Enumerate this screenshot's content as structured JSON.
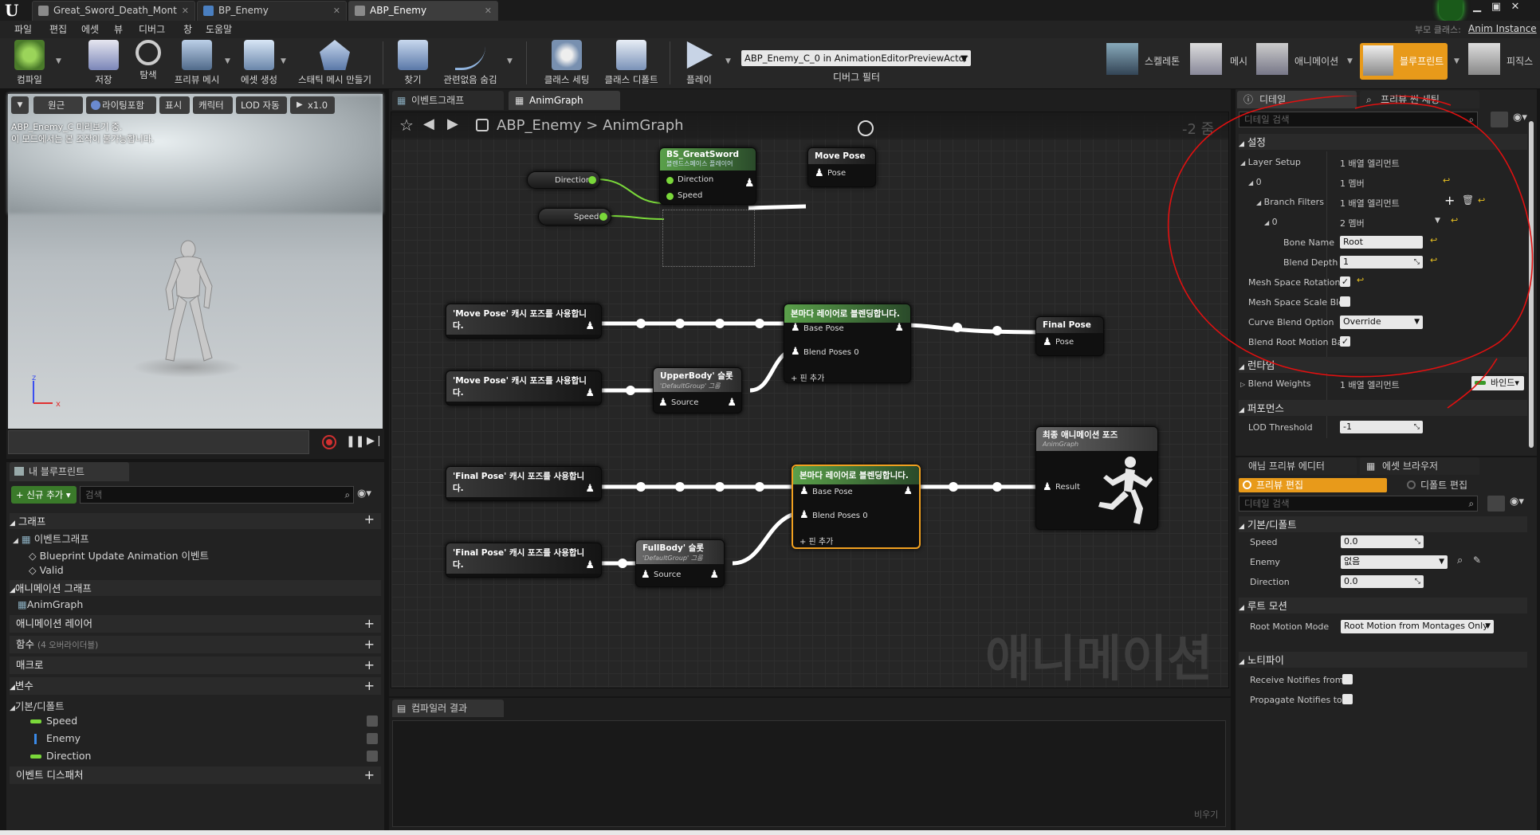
{
  "tabs": [
    {
      "label": "Great_Sword_Death_Mont"
    },
    {
      "label": "BP_Enemy"
    },
    {
      "label": "ABP_Enemy"
    }
  ],
  "parent_class_label": "부모 클래스:",
  "parent_class_value": "Anim Instance",
  "menu": [
    "파일",
    "편집",
    "에셋",
    "뷰",
    "디버그",
    "창",
    "도움말"
  ],
  "toolbar": {
    "compile": "컴파일",
    "save": "저장",
    "browse": "탐색",
    "preview_mesh": "프리뷰 메시",
    "create_asset": "에셋 생성",
    "make_static_mesh": "스태틱 메시 만들기",
    "find": "찾기",
    "hide_unrelated": "관련없음 숨김",
    "class_settings": "클래스 세팅",
    "class_defaults": "클래스 디폴트",
    "play": "플레이",
    "debug_select": "ABP_Enemy_C_0 in AnimationEditorPreviewActor",
    "debug_filter": "디버그 필터"
  },
  "modes": {
    "skeleton": "스켈레톤",
    "mesh": "메시",
    "animation": "애니메이션",
    "blueprint": "블루프린트",
    "physics": "피직스"
  },
  "viewport": {
    "btn_perspective": "원근",
    "btn_lighting": "라이팅포함",
    "btn_show": "표시",
    "btn_character": "캐릭터",
    "btn_lod": "LOD 자동",
    "btn_speed": "x1.0",
    "info1": "ABP_Enemy_C 미리보기 중.",
    "info2": "이 모드에서는 본 조작이 불가능합니다."
  },
  "my_blueprint": {
    "tab": "내 블루프린트",
    "add_new": "+ 신규 추가",
    "search_placeholder": "검색",
    "graphs": "그래프",
    "event_graph": "이벤트그래프",
    "bp_update": "Blueprint Update Animation 이벤트",
    "valid": "Valid",
    "anim_graphs": "애니메이션 그래프",
    "anim_graph": "AnimGraph",
    "anim_layers": "애니메이션 레이어",
    "functions": "함수",
    "functions_count": "(4 오버라이더블)",
    "macros": "매크로",
    "variables": "변수",
    "default_cat": "기본/디폴트",
    "var_speed": "Speed",
    "var_enemy": "Enemy",
    "var_direction": "Direction",
    "dispatchers": "이벤트 디스패처"
  },
  "graph": {
    "tab_event": "이벤트그래프",
    "tab_anim": "AnimGraph",
    "crumb_root": "ABP_Enemy",
    "crumb_sep": ">",
    "crumb_leaf": "AnimGraph",
    "zoom": "-2 줌",
    "watermark": "애니메이션",
    "n_direction": "Direction",
    "n_speed": "Speed",
    "n_bs_title": "BS_GreatSword",
    "n_bs_sub": "블렌드스페이스 플레이어",
    "n_bs_dir": "Direction",
    "n_bs_speed": "Speed",
    "n_movepose": "Move Pose",
    "n_pose": "Pose",
    "n_use_move1": "'Move Pose' 캐시 포즈를 사용합니다.",
    "n_use_move2": "'Move Pose' 캐시 포즈를 사용합니다.",
    "n_layer1": "본마다 레이어로 블렌딩합니다.",
    "n_base": "Base Pose",
    "n_blend0": "Blend Poses 0",
    "n_addpin": "+ 핀 추가",
    "n_upper": "UpperBody' 슬롯",
    "n_upper_sub": "'DefaultGroup' 그룹",
    "n_source": "Source",
    "n_finalpose": "Final Pose",
    "n_use_final1": "'Final Pose' 캐시 포즈를 사용합니다.",
    "n_use_final2": "'Final Pose' 캐시 포즈를 사용합니다.",
    "n_layer2": "본마다 레이어로 블렌딩합니다.",
    "n_full": "FullBody' 슬롯",
    "n_full_sub": "'DefaultGroup' 그룹",
    "n_output": "최종 애니메이션 포즈",
    "n_output_sub": "AnimGraph",
    "n_result": "Result"
  },
  "compiler": {
    "tab": "컴파일러 결과",
    "clear": "비우기"
  },
  "details": {
    "tab": "디테일",
    "tab2": "프리뷰 씬 세팅",
    "search": "디테일 검색",
    "settings": "설정",
    "layer_setup": "Layer Setup",
    "layer_setup_v": "1 배열 엘리먼트",
    "idx0": "0",
    "idx0_v": "1 멤버",
    "branch_filters": "Branch Filters",
    "branch_filters_v": "1 배열 엘리먼트",
    "idx0b": "0",
    "idx0b_v": "2 멤버",
    "bone_name": "Bone Name",
    "bone_name_v": "Root",
    "blend_depth": "Blend Depth",
    "blend_depth_v": "1",
    "mesh_rot": "Mesh Space Rotation",
    "mesh_scale": "Mesh Space Scale Ble",
    "curve_blend": "Curve Blend Option",
    "curve_blend_v": "Override",
    "blend_root": "Blend Root Motion Ba",
    "runtime": "런타임",
    "blend_weights": "Blend Weights",
    "blend_weights_v": "1 배열 엘리먼트",
    "bind": "바인드",
    "perf": "퍼포먼스",
    "lod": "LOD Threshold",
    "lod_v": "-1"
  },
  "preview_editor": {
    "tab": "애님 프리뷰 에디터",
    "tab2": "에셋 브라우저",
    "edit_preview": "프리뷰 편집",
    "edit_defaults": "디폴트 편집",
    "search": "디테일 검색",
    "default_cat": "기본/디폴트",
    "speed": "Speed",
    "speed_v": "0.0",
    "enemy": "Enemy",
    "enemy_v": "없음",
    "direction": "Direction",
    "direction_v": "0.0",
    "root_motion": "루트 모션",
    "root_motion_mode": "Root Motion Mode",
    "root_motion_mode_v": "Root Motion from Montages Only",
    "notify": "노티파이",
    "receive_notifies": "Receive Notifies from",
    "propagate": "Propagate Notifies to"
  },
  "colors": {
    "accent": "#e89a1a",
    "annotation": "#e01010",
    "exec_green": "#7ad83a"
  }
}
